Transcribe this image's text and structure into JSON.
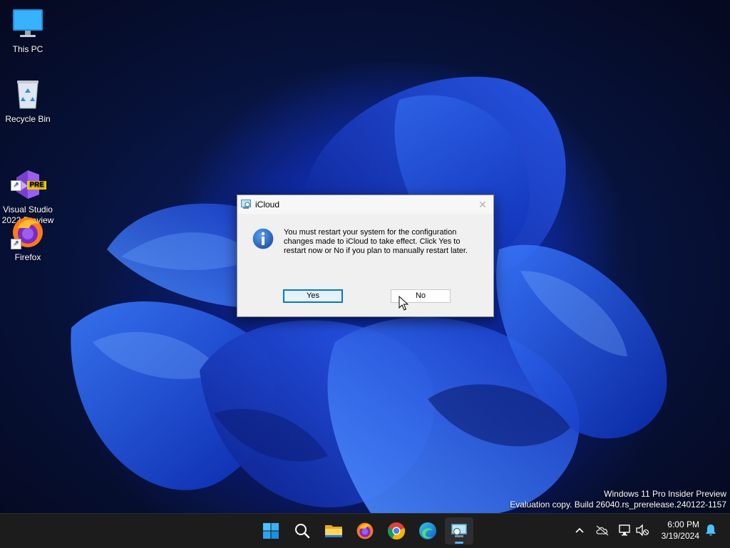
{
  "desktop": {
    "icons": [
      {
        "label": "This PC",
        "icon": "monitor-icon"
      },
      {
        "label": "Recycle Bin",
        "icon": "recycle-bin-icon"
      },
      {
        "label": "Visual Studio\n2022 Preview",
        "icon": "visual-studio-icon",
        "badge": "PRE"
      },
      {
        "label": "Firefox",
        "icon": "firefox-icon"
      }
    ],
    "watermark": {
      "line1": "Windows 11 Pro Insider Preview",
      "line2": "Evaluation copy. Build 26040.rs_prerelease.240122-1157"
    }
  },
  "dialog": {
    "title": "iCloud",
    "icon": "info-icon",
    "message": "You must restart your system for the configuration\nchanges made to iCloud to take effect. Click Yes to\nrestart now or No if you plan to manually restart later.",
    "yes_label": "Yes",
    "no_label": "No",
    "close_glyph": "✕"
  },
  "taskbar": {
    "apps": [
      {
        "name": "start-button",
        "icon": "windows-logo-icon"
      },
      {
        "name": "search-button",
        "icon": "search-icon"
      },
      {
        "name": "file-explorer-button",
        "icon": "folder-icon"
      },
      {
        "name": "firefox-button",
        "icon": "firefox-icon"
      },
      {
        "name": "chrome-button",
        "icon": "chrome-icon"
      },
      {
        "name": "edge-button",
        "icon": "edge-icon"
      },
      {
        "name": "icloud-taskbar-button",
        "icon": "icloud-setup-icon",
        "active": true
      }
    ],
    "tray": {
      "chevron": "^",
      "time": "6:00 PM",
      "date": "3/19/2024"
    }
  },
  "colors": {
    "accent": "#0078d7",
    "taskbar": "#1c1c1c",
    "dialog_bg": "#f0f0f0"
  }
}
